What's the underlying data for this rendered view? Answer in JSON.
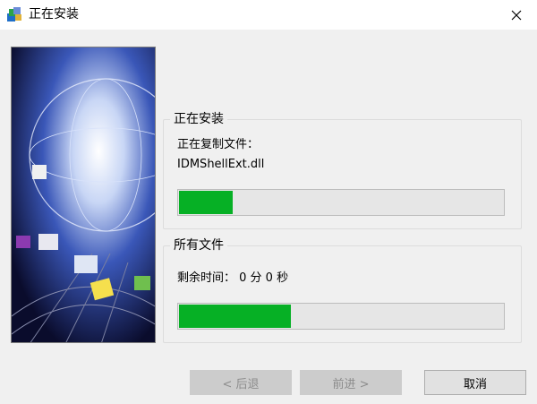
{
  "window": {
    "title": "正在安装",
    "icon": "installer-app-icon"
  },
  "titlebar": {
    "close_icon": "close-icon"
  },
  "group_current": {
    "legend": "正在安装",
    "status_label": "正在复制文件：",
    "file_name": "IDMShellExt.dll",
    "progress": 0.17
  },
  "group_all": {
    "legend": "所有文件",
    "remaining_time": "剩余时间： 0 分 0 秒",
    "progress": 0.35
  },
  "buttons": {
    "back_label": "< 后退",
    "next_label": "前进 >",
    "cancel_label": "取消"
  },
  "colors": {
    "progress_fill": "#06b025",
    "progress_track": "#e6e6e6"
  }
}
